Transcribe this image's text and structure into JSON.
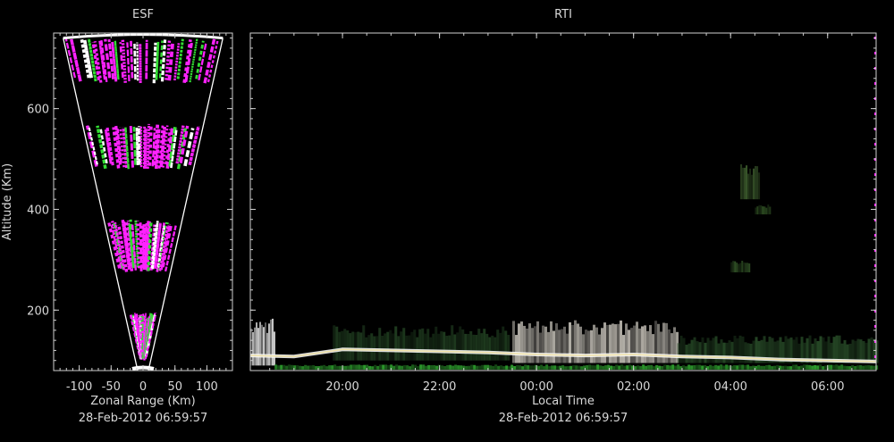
{
  "colors": {
    "background": "#000000",
    "axis": "#cfcfcf",
    "text": "#d8d8d8",
    "magenta": "#ff22ff",
    "green": "#33dd33",
    "white": "#ffffff"
  },
  "chart_data": [
    {
      "type": "heatmap",
      "title": "ESF",
      "xlabel": "Zonal Range (Km)",
      "ylabel": "Altitude (Km)",
      "caption": "28-Feb-2012 06:59:57",
      "xlim": [
        -140,
        140
      ],
      "ylim": [
        80,
        750
      ],
      "xticks": [
        -100,
        -50,
        0,
        50,
        100
      ],
      "xtick_labels": [
        "-100",
        "-50",
        "0",
        "50",
        "100"
      ],
      "yticks": [
        200,
        400,
        600
      ],
      "ytick_labels": [
        "200",
        "400",
        "600"
      ],
      "fan": {
        "apex_altitude": 80,
        "top_altitude": 740,
        "top_half_width": 125
      },
      "echo_bands": [
        {
          "altitude_min": 650,
          "altitude_max": 740,
          "color": "magenta"
        },
        {
          "altitude_min": 480,
          "altitude_max": 570,
          "color": "magenta"
        },
        {
          "altitude_min": 275,
          "altitude_max": 380,
          "color": "magenta"
        },
        {
          "altitude_min": 100,
          "altitude_max": 195,
          "color": "magenta"
        }
      ]
    },
    {
      "type": "heatmap",
      "title": "RTI",
      "xlabel": "Local Time",
      "caption": "28-Feb-2012 06:59:57",
      "xlim": [
        18.1,
        31.0
      ],
      "ylim": [
        80,
        750
      ],
      "xticks": [
        20,
        22,
        24,
        26,
        28,
        30
      ],
      "xtick_labels": [
        "20:00",
        "22:00",
        "00:00",
        "02:00",
        "04:00",
        "06:00"
      ],
      "yticks": [
        200,
        400,
        600
      ],
      "echo_regions": [
        {
          "time_start": 18.1,
          "time_end": 18.6,
          "alt_min": 90,
          "alt_max": 185,
          "color": "#c8c8c8"
        },
        {
          "time_start": 18.6,
          "time_end": 31.0,
          "alt_min": 82,
          "alt_max": 92,
          "color": "#2c9a2c"
        },
        {
          "time_start": 19.8,
          "time_end": 23.4,
          "alt_min": 100,
          "alt_max": 170,
          "color": "#1e3a1e"
        },
        {
          "time_start": 23.5,
          "time_end": 26.9,
          "alt_min": 95,
          "alt_max": 180,
          "color": "#b4b0a8"
        },
        {
          "time_start": 26.9,
          "time_end": 31.0,
          "alt_min": 95,
          "alt_max": 150,
          "color": "#244524"
        },
        {
          "time_start": 28.2,
          "time_end": 28.6,
          "alt_min": 420,
          "alt_max": 490,
          "color": "#3e5e2e"
        },
        {
          "time_start": 28.5,
          "time_end": 28.8,
          "alt_min": 390,
          "alt_max": 410,
          "color": "#2e4e22"
        },
        {
          "time_start": 28.0,
          "time_end": 28.4,
          "alt_min": 275,
          "alt_max": 300,
          "color": "#2f4f25"
        }
      ],
      "echo_layer": [
        {
          "t": 18.1,
          "alt": 110
        },
        {
          "t": 19.0,
          "alt": 108
        },
        {
          "t": 20.0,
          "alt": 122
        },
        {
          "t": 21.0,
          "alt": 120
        },
        {
          "t": 22.0,
          "alt": 118
        },
        {
          "t": 23.0,
          "alt": 116
        },
        {
          "t": 24.0,
          "alt": 112
        },
        {
          "t": 25.0,
          "alt": 110
        },
        {
          "t": 26.0,
          "alt": 112
        },
        {
          "t": 27.0,
          "alt": 108
        },
        {
          "t": 28.0,
          "alt": 106
        },
        {
          "t": 29.0,
          "alt": 102
        },
        {
          "t": 30.0,
          "alt": 100
        },
        {
          "t": 31.0,
          "alt": 98
        }
      ]
    }
  ]
}
